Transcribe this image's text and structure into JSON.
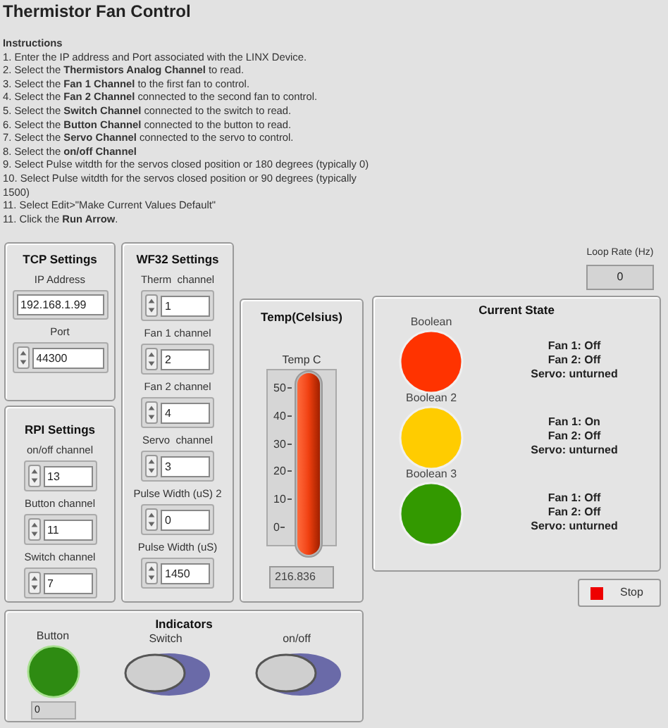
{
  "title": "Thermistor Fan Control",
  "instructions": {
    "heading": "Instructions",
    "lines": [
      "1. Enter the IP address and Port associated with the LINX Device.",
      "2. Select the **Thermistors Analog Channel** to read.",
      "3. Select the **Fan 1 Channel** to the first fan to control.",
      "4. Select the **Fan 2 Channel** connected to the second fan to control.",
      "5. Select the **Switch Channel** connected to the switch to read.",
      "6. Select the **Button Channel** connected to the button to read.",
      "7. Select the **Servo Channel** connected to the servo to control.",
      "8. Select the **on/off Channel**",
      "9. Select Pulse witdth for the servos closed position or 180 degrees (typically 0)",
      "10. Select Pulse witdth for the servos closed position or 90 degrees (typically 1500)",
      "11. Select Edit>\"Make Current Values Default\"",
      "11. Click the **Run Arrow**."
    ]
  },
  "tcp_settings": {
    "title": "TCP Settings",
    "fields": [
      {
        "label": "IP Address",
        "value": "192.168.1.99",
        "kind": "text"
      },
      {
        "label": "Port",
        "value": "44300",
        "kind": "numeric"
      }
    ]
  },
  "rpi_settings": {
    "title": "RPI Settings",
    "fields": [
      {
        "label": "on/off channel",
        "value": "13",
        "kind": "numeric"
      },
      {
        "label": "Button channel",
        "value": "11",
        "kind": "numeric"
      },
      {
        "label": "Switch channel",
        "value": "7",
        "kind": "numeric"
      }
    ]
  },
  "wf32_settings": {
    "title": "WF32 Settings",
    "fields": [
      {
        "label": "Therm  channel",
        "value": "1",
        "kind": "numeric"
      },
      {
        "label": "Fan 1 channel",
        "value": "2",
        "kind": "numeric"
      },
      {
        "label": "Fan 2 channel",
        "value": "4",
        "kind": "numeric"
      },
      {
        "label": "Servo  channel",
        "value": "3",
        "kind": "numeric"
      },
      {
        "label": "Pulse Width (uS) 2",
        "value": "0",
        "kind": "numeric"
      },
      {
        "label": "Pulse Width (uS)",
        "value": "1450",
        "kind": "numeric"
      }
    ]
  },
  "temperature": {
    "title": "Temp(Celsius)",
    "label": "Temp C",
    "ticks": [
      "50",
      "40",
      "30",
      "20",
      "10",
      "0"
    ],
    "level": 1,
    "reading": "216.836"
  },
  "loop_rate": {
    "label": "Loop Rate (Hz)",
    "value": "0"
  },
  "current_state": {
    "title": "Current State",
    "items": [
      {
        "label": "Boolean",
        "color": "#ff3300",
        "lines": [
          "Fan 1: Off",
          "Fan 2: Off",
          "Servo: unturned"
        ]
      },
      {
        "label": "Boolean 2",
        "color": "#ffcc00",
        "lines": [
          "Fan 1: On",
          "Fan 2: Off",
          "Servo: unturned"
        ]
      },
      {
        "label": "Boolean 3",
        "color": "#339900",
        "lines": [
          "Fan 1: Off",
          "Fan 2: Off",
          "Servo: unturned"
        ]
      }
    ]
  },
  "stop_button": {
    "label": "Stop"
  },
  "indicators": {
    "title": "Indicators",
    "items": [
      {
        "kind": "led",
        "label": "Button",
        "on": true,
        "reading": "0"
      },
      {
        "kind": "switch",
        "label": "Switch",
        "on": false
      },
      {
        "kind": "switch",
        "label": "on/off",
        "on": false
      }
    ]
  }
}
